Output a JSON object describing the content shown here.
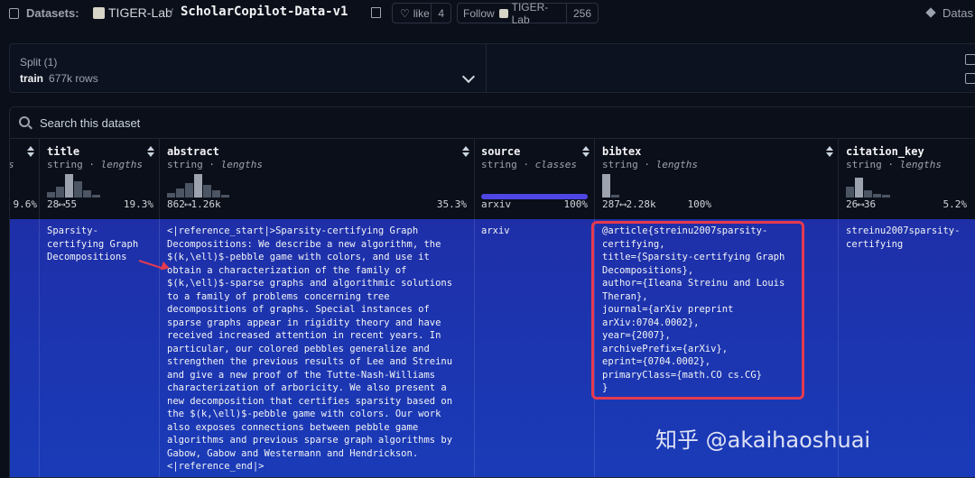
{
  "header": {
    "datasets_label": "Datasets:",
    "org": "TIGER-Lab",
    "slash": "/",
    "repo": "ScholarCopilot-Data-v1",
    "like_label": "like",
    "like_count": "4",
    "follow_label": "Follow",
    "follow_org": "TIGER-Lab",
    "follow_count": "256",
    "right_label": "Datas"
  },
  "split": {
    "title": "Split (1)",
    "name": "train",
    "rows": "677k rows"
  },
  "search": {
    "placeholder": "Search this dataset"
  },
  "columns": [
    {
      "name": "",
      "type": "",
      "kind": "",
      "stat_left": "",
      "stat_right": "9.6%"
    },
    {
      "name": "title",
      "type": "string",
      "kind": "lengths",
      "stat_left": "28⟷55",
      "stat_right": "19.3%"
    },
    {
      "name": "abstract",
      "type": "string",
      "kind": "lengths",
      "stat_left": "862⟷1.26k",
      "stat_right": "35.3%"
    },
    {
      "name": "source",
      "type": "string",
      "kind": "classes",
      "stat_left": "arxiv",
      "stat_right": "100%"
    },
    {
      "name": "bibtex",
      "type": "string",
      "kind": "lengths",
      "stat_left": "287⟷2.28k",
      "stat_right": "100%"
    },
    {
      "name": "citation_key",
      "type": "string",
      "kind": "lengths",
      "stat_left": "26⟷36",
      "stat_right": "5.2%"
    }
  ],
  "row": {
    "title": "Sparsity-\ncertifying Graph\nDecompositions",
    "abstract": "<|reference_start|>Sparsity-certifying Graph\nDecompositions: We describe a new algorithm, the\n$(k,\\ell)$-pebble game with colors, and use it\nobtain a characterization of the family of\n$(k,\\ell)$-sparse graphs and algorithmic solutions\nto a family of problems concerning tree\ndecompositions of graphs. Special instances of\nsparse graphs appear in rigidity theory and have\nreceived increased attention in recent years. In\nparticular, our colored pebbles generalize and\nstrengthen the previous results of Lee and Streinu\nand give a new proof of the Tutte-Nash-Williams\ncharacterization of arboricity. We also present a\nnew decomposition that certifies sparsity based on\nthe $(k,\\ell)$-pebble game with colors. Our work\nalso exposes connections between pebble game\nalgorithms and previous sparse graph algorithms by\nGabow, Gabow and Westermann and Hendrickson.\n<|reference_end|>",
    "source": "arxiv",
    "bibtex": "@article{streinu2007sparsity-\ncertifying,\ntitle={Sparsity-certifying Graph\nDecompositions},\nauthor={Ileana Streinu and Louis\nTheran},\njournal={arXiv preprint\narXiv:0704.0002},\nyear={2007},\narchivePrefix={arXiv},\neprint={0704.0002},\nprimaryClass={math.CO cs.CG}\n}",
    "citation_key": "streinu2007sparsity-\ncertifying"
  },
  "watermark": "知乎 @akaihaoshuai",
  "colors": {
    "row_highlight": "#1e2fa8",
    "annotation": "#e63a4f",
    "class_bar": "#4f46e5"
  }
}
